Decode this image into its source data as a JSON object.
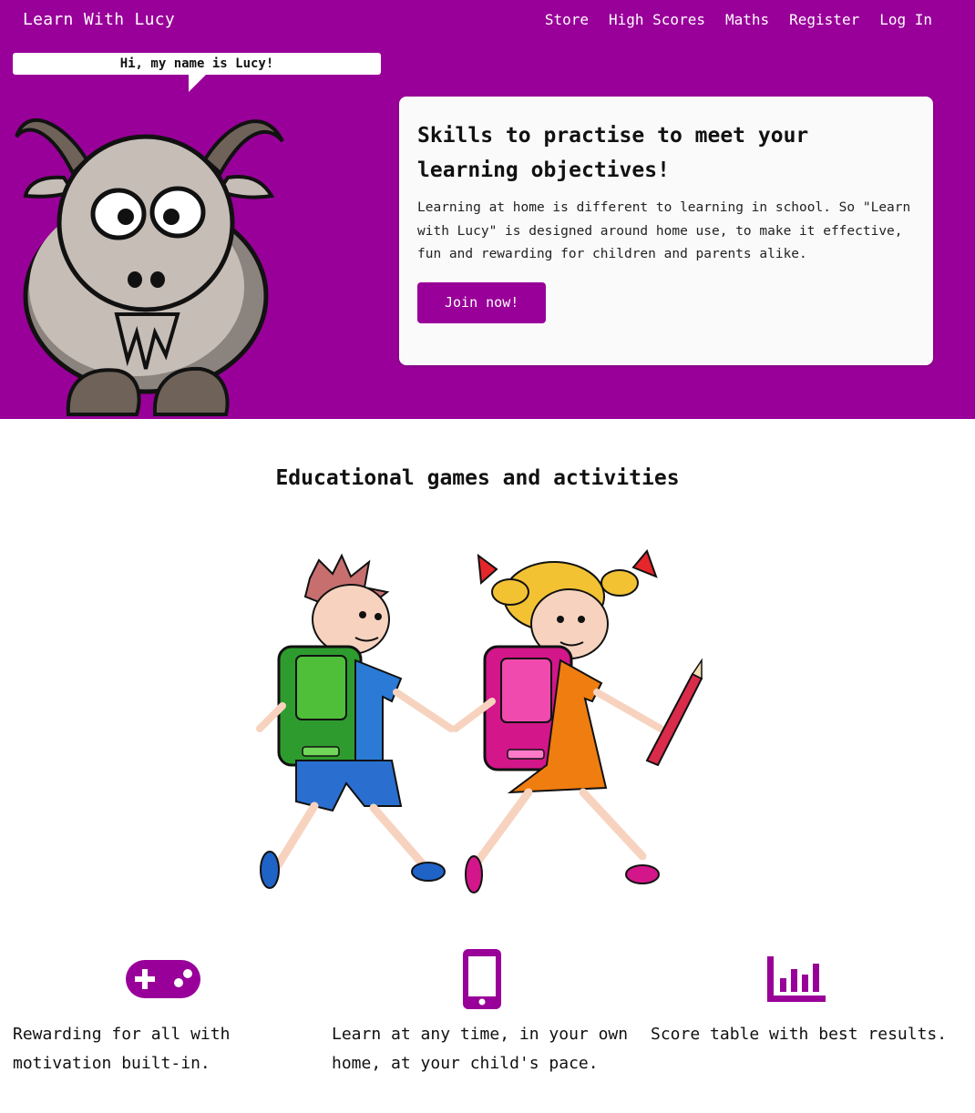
{
  "brand": {
    "name": "Learn With Lucy"
  },
  "nav": {
    "items": [
      {
        "label": "Store"
      },
      {
        "label": "High Scores"
      },
      {
        "label": "Maths"
      },
      {
        "label": "Register"
      },
      {
        "label": "Log In"
      }
    ]
  },
  "mascot": {
    "speech": "Hi, my name is Lucy!",
    "icon": "goat-illustration"
  },
  "hero_card": {
    "title": "Skills to practise to meet your learning objectives!",
    "body": "Learning at home is different to learning in school. So \"Learn with Lucy\" is designed around home use, to make it effective, fun and rewarding for children and parents alike.",
    "cta_label": "Join now!"
  },
  "section": {
    "title": "Educational games and activities",
    "illustration": "children-walking-illustration"
  },
  "features": [
    {
      "icon": "gamepad-icon",
      "text": "Rewarding for all with motivation built-in."
    },
    {
      "icon": "mobile-phone-icon",
      "text": "Learn at any time, in your own home, at your child's pace."
    },
    {
      "icon": "bar-chart-icon",
      "text": "Score table with best results."
    }
  ],
  "colors": {
    "brand_purple": "#990099",
    "card_bg": "#fafafa",
    "text": "#111111"
  }
}
